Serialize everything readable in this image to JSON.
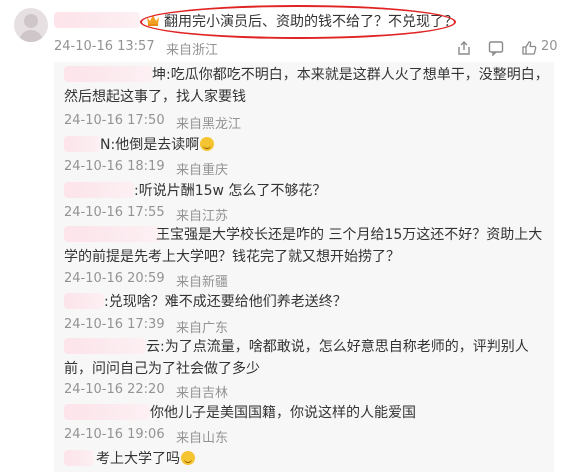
{
  "comment": {
    "text": "翻用完小演员后、资助的钱不给了？不兑现了？",
    "time": "24-10-16 13:57",
    "location": "来自浙江",
    "like_count": "20",
    "icons": [
      "share-icon",
      "comment-icon",
      "like-icon"
    ]
  },
  "replies": [
    {
      "text": "坤:吃瓜你都吃不明白，本来就是这群人火了想单干，没整明白，然后想起这事了，找人家要钱",
      "time": "24-10-16 17:50",
      "location": "来自黑龙江"
    },
    {
      "text": "N:他倒是去读啊",
      "time": "24-10-16 18:19",
      "location": "来自重庆"
    },
    {
      "text": ":听说片酬15w 怎么了不够花？",
      "time": "24-10-16 17:55",
      "location": "来自江苏"
    },
    {
      "text": "王宝强是大学校长还是咋的 三个月给15万这还不好？资助上大学的前提是先考上大学吧？钱花完了就又想开始捞了？",
      "time": "24-10-16 20:59",
      "location": "来自新疆"
    },
    {
      "text": ":兑现啥？难不成还要给他们养老送终？",
      "time": "24-10-16 17:39",
      "location": "来自广东"
    },
    {
      "text": "云:为了点流量，啥都敢说，怎么好意思自称老师的，评判别人前，问问自己为了社会做了多少",
      "time": "24-10-16 22:20",
      "location": "来自吉林"
    },
    {
      "text": "你他儿子是美国国籍，你说这样的人能爱国",
      "time": "24-10-16 19:06",
      "location": "来自山东"
    },
    {
      "text": "考上大学了吗",
      "time": "",
      "location": ""
    }
  ]
}
